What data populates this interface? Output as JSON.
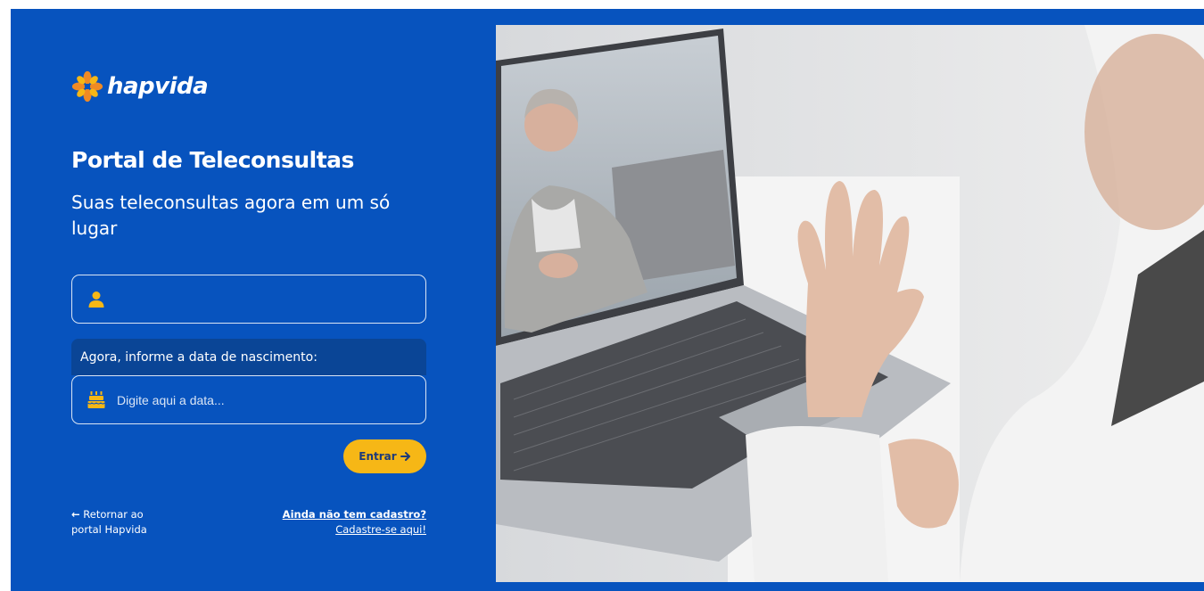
{
  "brand": {
    "name": "hapvida",
    "logo_color": "#f08a24",
    "accent": "#0753be"
  },
  "page": {
    "title": "Portal de Teleconsultas",
    "subtitle": "Suas teleconsultas agora em um só lugar"
  },
  "form": {
    "user_field": {
      "icon": "user-icon",
      "value": "",
      "placeholder": ""
    },
    "birth_label": "Agora, informe a data de nascimento:",
    "date_field": {
      "icon": "birthday-cake-icon",
      "value": "",
      "placeholder": "Digite aqui a data..."
    },
    "submit_label": "Entrar",
    "submit_color": "#f6b716"
  },
  "links": {
    "back_line1": "Retornar ao",
    "back_line2": "portal Hapvida",
    "signup_question": "Ainda não tem cadastro?",
    "signup_action": "Cadastre-se aqui!"
  }
}
